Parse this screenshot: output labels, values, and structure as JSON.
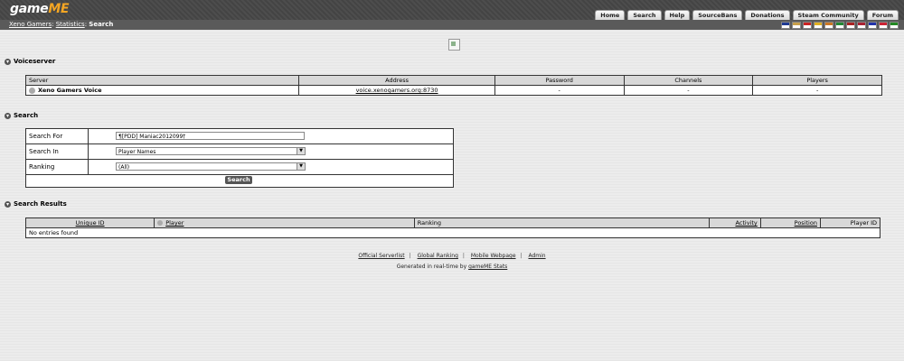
{
  "header": {
    "logo_text": "game",
    "logo_accent": "ME",
    "nav": [
      {
        "label": "Home"
      },
      {
        "label": "Search"
      },
      {
        "label": "Help"
      },
      {
        "label": "SourceBans"
      },
      {
        "label": "Donations"
      },
      {
        "label": "Steam Community"
      },
      {
        "label": "Forum"
      }
    ]
  },
  "breadcrumb": {
    "items": [
      "Xeno Gamers",
      "Statistics"
    ],
    "sep": ":",
    "current": "Search"
  },
  "flags": [
    "#1f3a93",
    "#c8a04a",
    "#cc2222",
    "#e0b020",
    "#cc7722",
    "#228833",
    "#aa2222",
    "#aa2233",
    "#2233aa",
    "#cc2233",
    "#228822"
  ],
  "voiceserver": {
    "heading": "Voiceserver",
    "columns": [
      "Server",
      "Address",
      "Password",
      "Channels",
      "Players"
    ],
    "row": {
      "server": "Xeno Gamers Voice",
      "address": "voice.xenogamers.org:8730",
      "password": "-",
      "channels": "-",
      "players": "-"
    }
  },
  "search": {
    "heading": "Search",
    "for_label": "Search For",
    "for_value": "¶[PDD] Maniac2012099†",
    "in_label": "Search In",
    "in_value": "Player Names",
    "ranking_label": "Ranking",
    "ranking_value": "(All)",
    "button": "Search"
  },
  "results": {
    "heading": "Search Results",
    "columns": [
      "Unique ID",
      "Player",
      "Ranking",
      "Activity",
      "Position",
      "Player ID"
    ],
    "empty": "No entries found"
  },
  "footer": {
    "links": [
      "Official Serverlist",
      "Global Ranking",
      "Mobile Webpage",
      "Admin"
    ],
    "generated_prefix": "Generated in real-time by",
    "generated_link": "gameME Stats"
  }
}
